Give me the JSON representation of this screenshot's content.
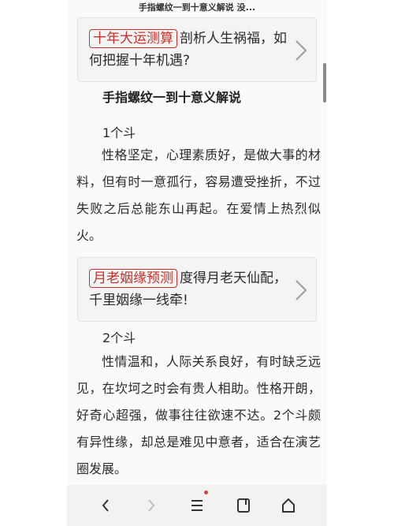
{
  "page": {
    "title": "手指螺纹一到十意义解说 没..."
  },
  "cards": [
    {
      "tag": "十年大运测算",
      "text": "剖析人生祸福，如何把握十年机遇?"
    },
    {
      "tag": "月老姻缘预测",
      "text": "度得月老天仙配，千里姻缘一线牵!"
    }
  ],
  "article": {
    "heading": "手指螺纹一到十意义解说",
    "sections": [
      {
        "title": "1个斗",
        "body": "性格坚定，心理素质好，是做大事的材料，但有时一意孤行，容易遭受挫折，不过失败之后总能东山再起。在爱情上热烈似火。"
      },
      {
        "title": "2个斗",
        "body": "性情温和，人际关系良好，有时缺乏远见，在坎坷之时会有贵人相助。性格开朗，好奇心超强，做事往往欲速不达。2个斗颇有异性缘，却总是难见中意者，适合在演艺圈发展。"
      }
    ]
  },
  "nav": {
    "items": [
      "back-icon",
      "forward-icon",
      "menu-icon",
      "tabs-icon",
      "home-icon"
    ],
    "accent": "#e23b3b"
  },
  "colors": {
    "tag_red": "#c9302c",
    "card_bg": "#f4f4f4"
  }
}
